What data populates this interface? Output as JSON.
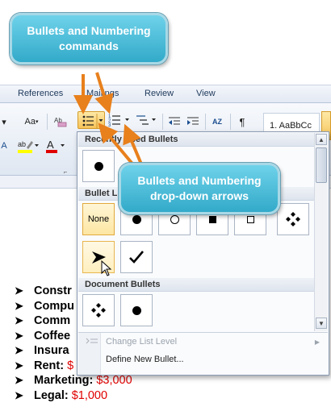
{
  "ribbon": {
    "tabs": [
      "References",
      "Mailings",
      "Review",
      "View"
    ],
    "styles_preview": "1. AaBbCc",
    "change_case": "Aa",
    "sort_icon": "AZ",
    "pilcrow": "¶"
  },
  "dropdown": {
    "recent_header": "Recently Used Bullets",
    "library_header": "Bullet Library",
    "none_label": "None",
    "document_header": "Document Bullets",
    "change_level": "Change List Level",
    "define_new": "Define New Bullet..."
  },
  "document": {
    "items": [
      {
        "label": "Constr",
        "amount": ""
      },
      {
        "label": "Compu",
        "amount": ""
      },
      {
        "label": "Comm",
        "amount": ""
      },
      {
        "label": "Coffee",
        "amount": ""
      },
      {
        "label": "Insura",
        "amount": ""
      },
      {
        "label": "Rent:",
        "amount": "$"
      },
      {
        "label": "Marketing:",
        "amount": "$3,000"
      },
      {
        "label": "Legal:",
        "amount": "$1,000"
      }
    ]
  },
  "callouts": {
    "top": "Bullets and Numbering commands",
    "bottom": "Bullets and Numbering drop-down arrows"
  },
  "colors": {
    "callout": "#3fb5d3",
    "arrow": "#e8801c",
    "amount": "#e00000",
    "highlight": "#f6c35a"
  },
  "icons": {
    "bullet_library": [
      "none",
      "dot",
      "circle",
      "square",
      "diamond-cluster",
      "arrowhead",
      "checkmark"
    ],
    "document_bullets": [
      "diamond-cluster",
      "dot"
    ]
  }
}
